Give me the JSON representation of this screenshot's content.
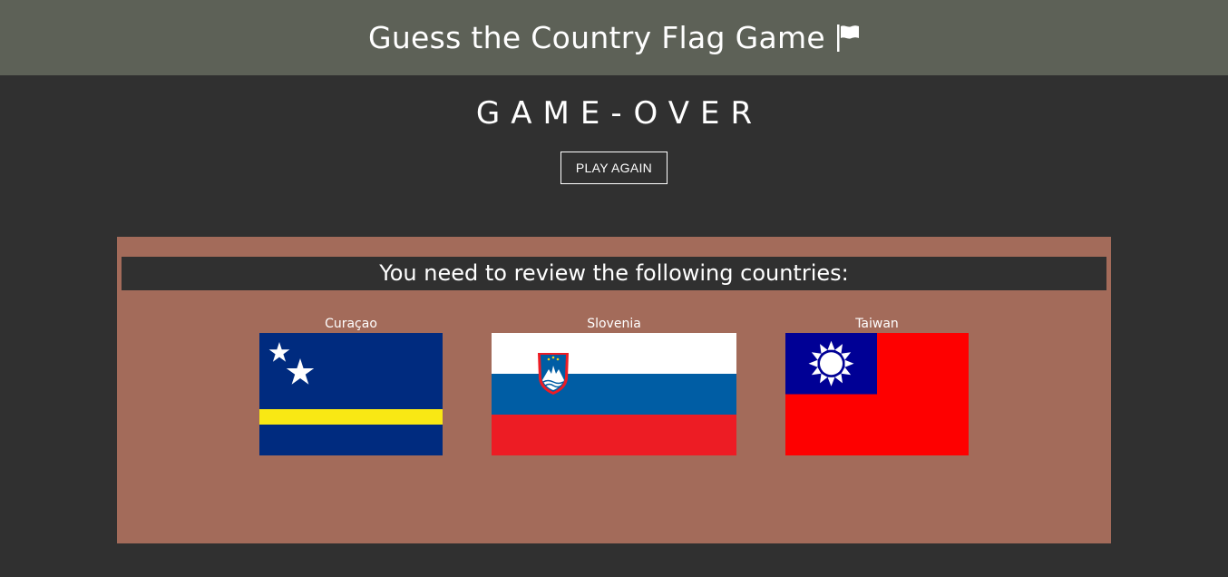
{
  "header": {
    "title": "Guess the Country Flag Game",
    "icon": "flag-icon"
  },
  "status": {
    "text": "GAME-OVER"
  },
  "actions": {
    "play_again_label": "PLAY AGAIN"
  },
  "review": {
    "heading": "You need to review the following countries:",
    "countries": [
      {
        "name": "Curaçao"
      },
      {
        "name": "Slovenia"
      },
      {
        "name": "Taiwan"
      }
    ]
  },
  "colors": {
    "header_bg": "#5d6157",
    "page_bg": "#303030",
    "panel_bg": "#a36b5a"
  }
}
